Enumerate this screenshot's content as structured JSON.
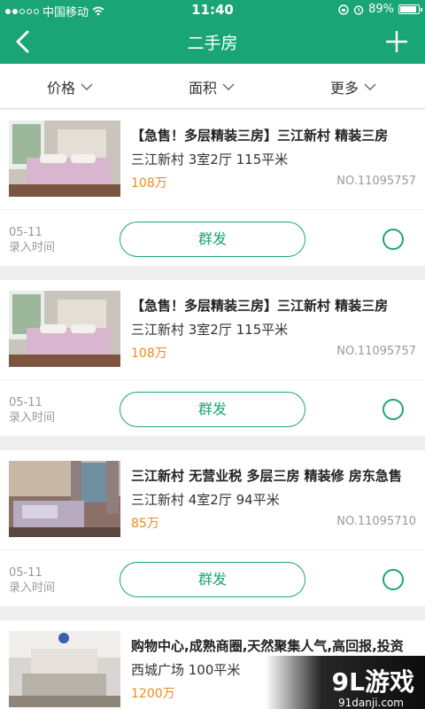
{
  "statusbar": {
    "carrier": "中国移动",
    "time": "11:40",
    "battery": "89%"
  },
  "navbar": {
    "title": "二手房"
  },
  "filters": [
    {
      "label": "价格"
    },
    {
      "label": "面积"
    },
    {
      "label": "更多"
    }
  ],
  "listings": [
    {
      "title": "【急售！多层精装三房】三江新村 精装三房",
      "subtitle": "三江新村 3室2厅 115平米",
      "price": "108万",
      "code": "NO.11095757",
      "date": "05-11",
      "date_label": "录入时间",
      "action": "群发"
    },
    {
      "title": "【急售！多层精装三房】三江新村 精装三房",
      "subtitle": "三江新村 3室2厅 115平米",
      "price": "108万",
      "code": "NO.11095757",
      "date": "05-11",
      "date_label": "录入时间",
      "action": "群发"
    },
    {
      "title": "三江新村 无营业税 多层三房 精装修 房东急售",
      "subtitle": "三江新村 4室2厅 94平米",
      "price": "85万",
      "code": "NO.11095710",
      "date": "05-11",
      "date_label": "录入时间",
      "action": "群发"
    },
    {
      "title": "购物中心,成熟商圈,天然聚集人气,高回报,投资",
      "subtitle": "西城广场 100平米",
      "price": "1200万",
      "code": "",
      "date": "",
      "date_label": "",
      "action": ""
    }
  ],
  "watermark": {
    "logo": "9L游戏",
    "site": "91danji.com"
  },
  "colors": {
    "brand": "#1aa577",
    "price": "#f08a1c"
  }
}
